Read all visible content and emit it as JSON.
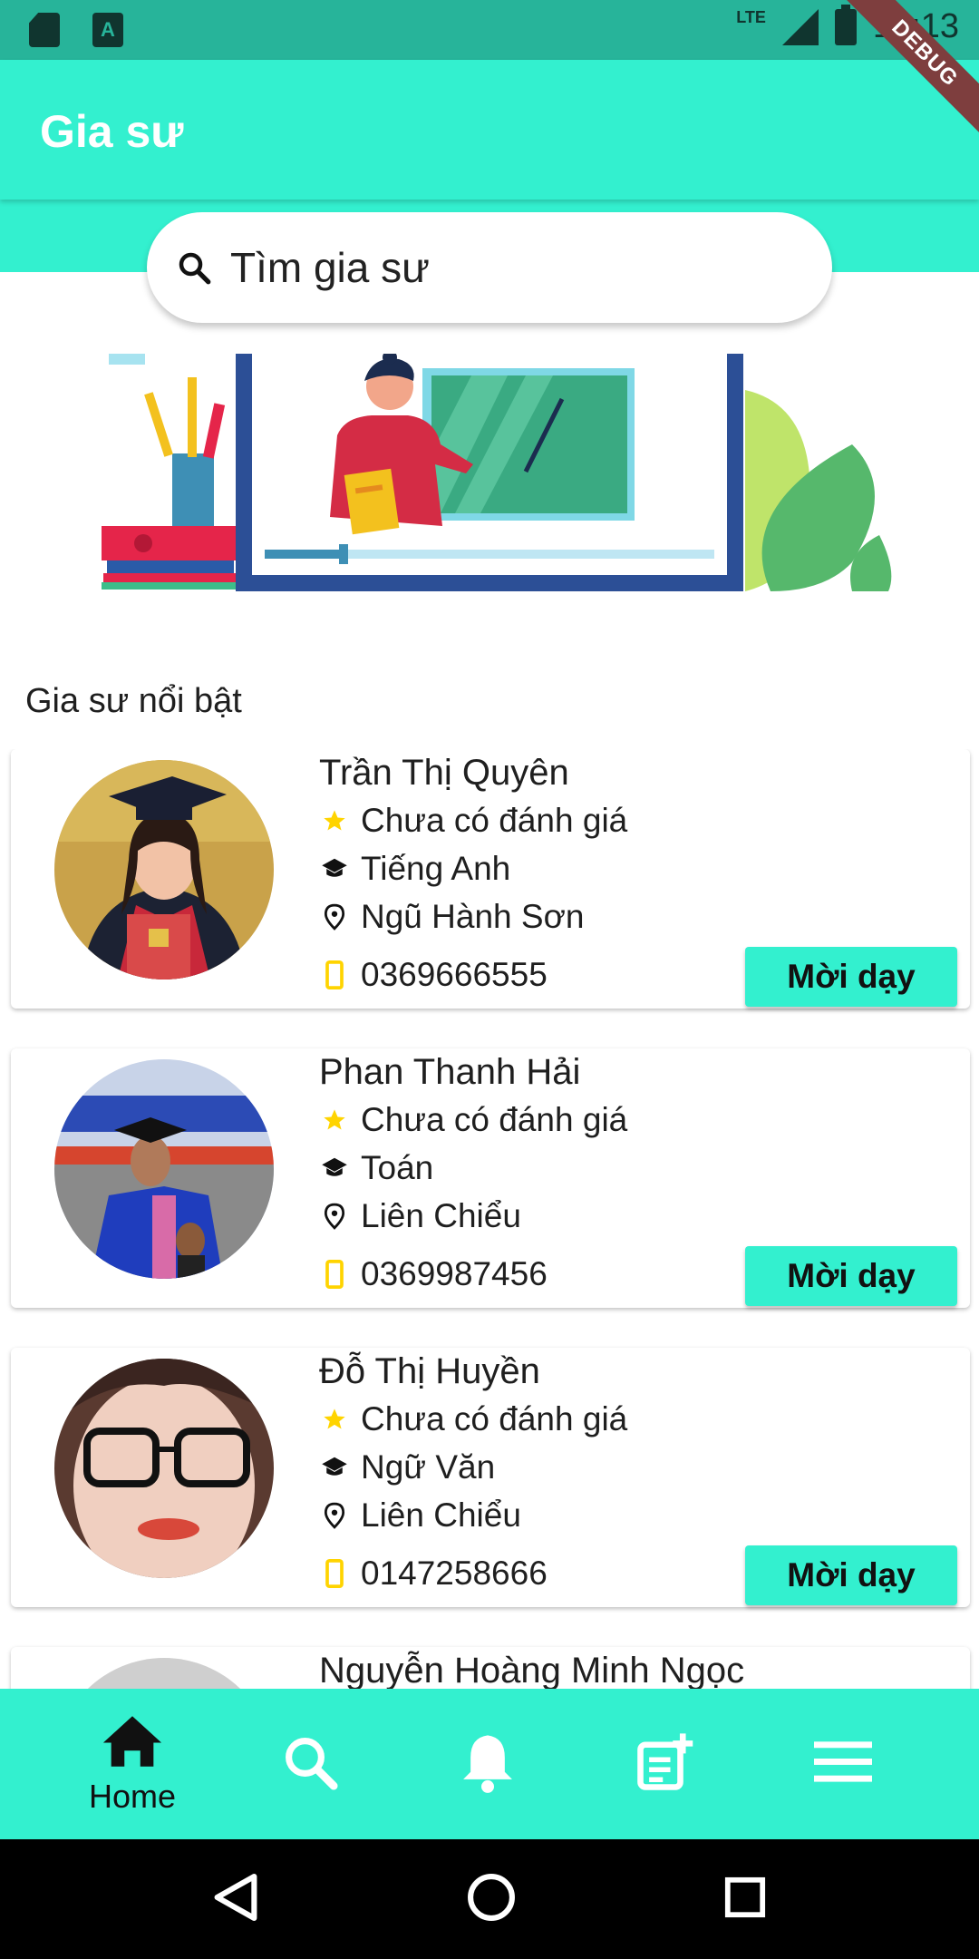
{
  "status_bar": {
    "network": "LTE",
    "time": "10:13"
  },
  "debug_label": "DEBUG",
  "app_bar": {
    "title": "Gia sư"
  },
  "search": {
    "placeholder": "Tìm gia sư"
  },
  "section_title": "Gia sư nổi bật",
  "tutors": [
    {
      "name": "Trần Thị Quyên",
      "rating": "Chưa có đánh giá",
      "subject": "Tiếng Anh",
      "location": "Ngũ Hành Sơn",
      "phone": "0369666555",
      "button": "Mời dạy"
    },
    {
      "name": "Phan Thanh Hải",
      "rating": "Chưa có đánh giá",
      "subject": "Toán",
      "location": "Liên Chiểu",
      "phone": "0369987456",
      "button": "Mời dạy"
    },
    {
      "name": "Đỗ Thị Huyền",
      "rating": "Chưa có đánh giá",
      "subject": "Ngữ Văn",
      "location": "Liên Chiểu",
      "phone": "0147258666",
      "button": "Mời dạy"
    },
    {
      "name": "Nguyễn Hoàng Minh Ngọc"
    }
  ],
  "icons": {
    "rating": "star-icon",
    "subject": "graduation-cap-icon",
    "location": "map-pin-icon",
    "phone": "phone-icon"
  },
  "colors": {
    "primary": "#33f0cf",
    "status_bar": "#27b49a",
    "star": "#ffd400"
  },
  "bottom_nav": [
    {
      "label": "Home",
      "icon": "home-icon"
    },
    {
      "icon": "search-icon"
    },
    {
      "icon": "bell-icon"
    },
    {
      "icon": "post-add-icon"
    },
    {
      "icon": "menu-icon"
    }
  ]
}
